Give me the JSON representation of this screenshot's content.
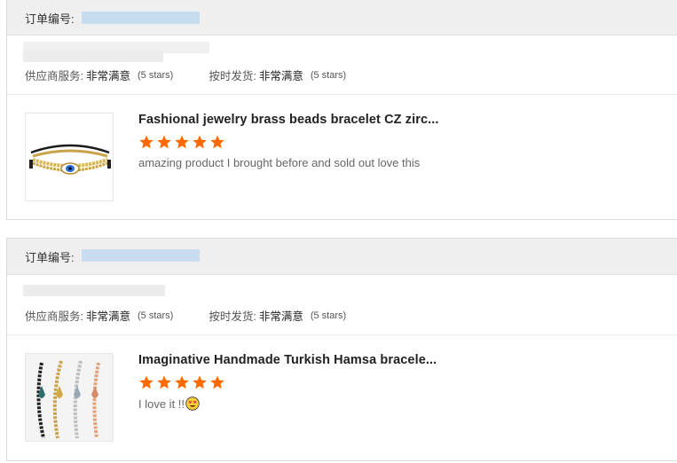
{
  "orders": [
    {
      "order_no_label": "订单编号:",
      "supplier_service_label": "供应商服务:",
      "supplier_service_value": "非常满意",
      "supplier_service_stars": "(5 stars)",
      "shipping_label": "按时发货:",
      "shipping_value": "非常满意",
      "shipping_stars": "(5 stars)",
      "product": {
        "title": "Fashional jewelry brass beads bracelet CZ zirc...",
        "rating": 5,
        "review": "amazing product I brought before and sold out love this",
        "image_icon": "gold-evil-eye-bracelet-icon"
      }
    },
    {
      "order_no_label": "订单编号:",
      "supplier_service_label": "供应商服务:",
      "supplier_service_value": "非常满意",
      "supplier_service_stars": "(5 stars)",
      "shipping_label": "按时发货:",
      "shipping_value": "非常满意",
      "shipping_stars": "(5 stars)",
      "product": {
        "title": "Imaginative Handmade Turkish Hamsa bracele...",
        "rating": 5,
        "review": "I love it !!",
        "review_emoji": "heart-eyes-emoji-icon",
        "image_icon": "hamsa-bead-bracelets-icon"
      }
    }
  ],
  "colors": {
    "star": "#ff6a00",
    "header_bg": "#efefef",
    "redaction": "#c7dcef"
  }
}
